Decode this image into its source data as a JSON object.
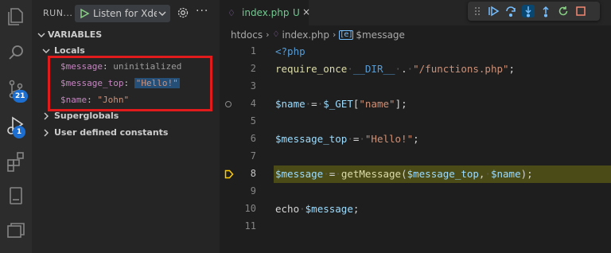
{
  "activity": {
    "scm_badge": "21",
    "debug_badge": "1"
  },
  "sidebar": {
    "title": "RUN...",
    "config_label": "Listen for Xdebug",
    "variables_label": "VARIABLES",
    "locals_label": "Locals",
    "locals": [
      {
        "name": "$message",
        "value": "uninitialized",
        "style": "plain"
      },
      {
        "name": "$message_top",
        "value": "\"Hello!\"",
        "style": "highlight"
      },
      {
        "name": "$name",
        "value": "\"John\"",
        "style": "string"
      }
    ],
    "superglobals_label": "Superglobals",
    "constants_label": "User defined constants"
  },
  "editor": {
    "tab": {
      "name": "index.php",
      "modified": "U",
      "close": "×"
    },
    "breadcrumb": {
      "folder": "htdocs",
      "file": "index.php",
      "symbol": "$message"
    },
    "line_numbers": [
      "1",
      "2",
      "3",
      "4",
      "5",
      "6",
      "7",
      "8",
      "9",
      "10",
      "11"
    ],
    "current_line": "8",
    "colors": {
      "highlight": "#4b4b18",
      "accent": "#e11b1b"
    }
  },
  "code_tokens": {
    "l1": "<?php",
    "l2_fn": "require_once",
    "l2_const": "__DIR__",
    "l2_op": ".",
    "l2_str": "\"/functions.php\"",
    "l2_end": ";",
    "l4_var": "$name",
    "l4_eq": "=",
    "l4_get": "$_GET",
    "l4_b1": "[",
    "l4_key": "\"name\"",
    "l4_b2": "];",
    "l6_var": "$message_top",
    "l6_eq": "=",
    "l6_str": "\"Hello!\"",
    "l6_end": ";",
    "l8_var": "$message",
    "l8_eq": "=",
    "l8_fn": "getMessage",
    "l8_p1": "(",
    "l8_a1": "$message_top",
    "l8_comma": ",",
    "l8_a2": "$name",
    "l8_p2": ");",
    "l10_kw": "echo",
    "l10_var": "$message",
    "l10_end": ";"
  }
}
